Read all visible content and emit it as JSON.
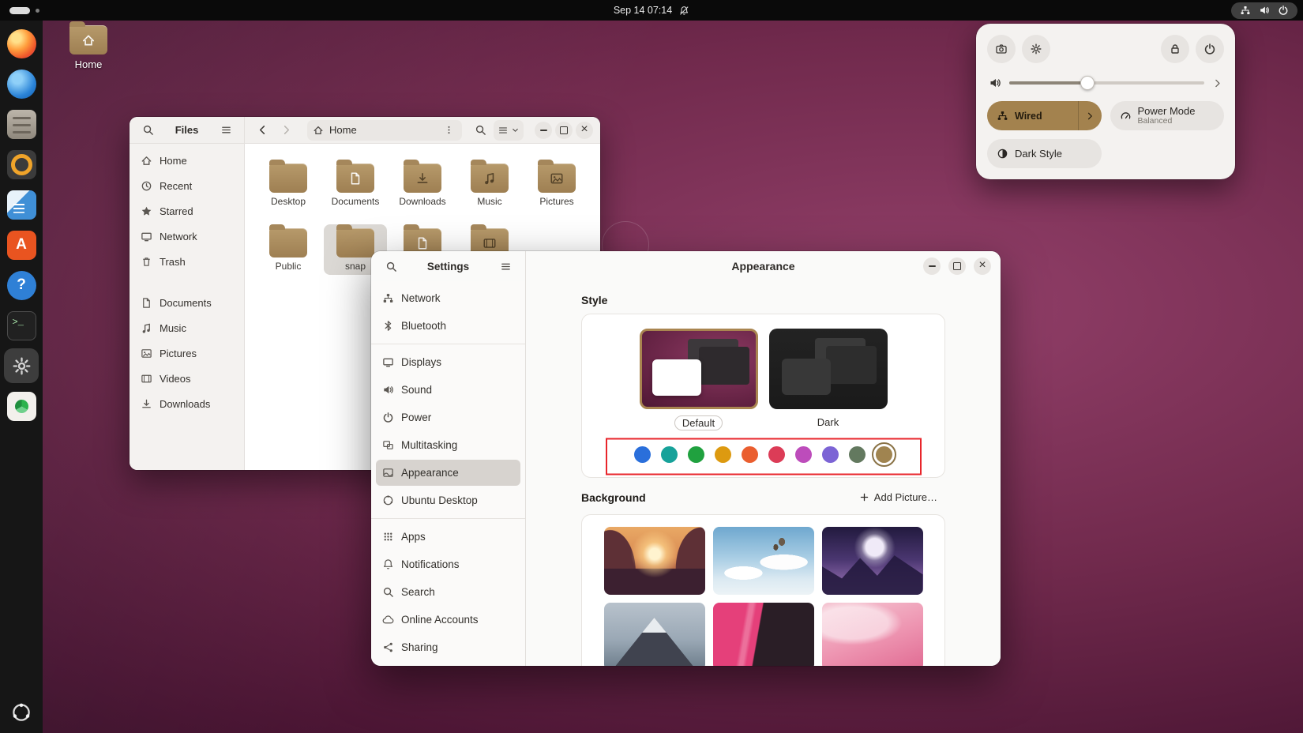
{
  "topbar": {
    "clock": "Sep 14 07:14"
  },
  "dock": {
    "items": [
      {
        "name": "firefox"
      },
      {
        "name": "thunderbird"
      },
      {
        "name": "files"
      },
      {
        "name": "rhythmbox"
      },
      {
        "name": "libreoffice-writer"
      },
      {
        "name": "ubuntu-software"
      },
      {
        "name": "help"
      },
      {
        "name": "terminal"
      },
      {
        "name": "settings",
        "active": true
      },
      {
        "name": "app-center"
      }
    ]
  },
  "desktop": {
    "home_icon_label": "Home"
  },
  "files_window": {
    "app_title": "Files",
    "tab_label": "Home",
    "sidebar_top": [
      {
        "label": "Home"
      },
      {
        "label": "Recent"
      },
      {
        "label": "Starred"
      },
      {
        "label": "Network"
      },
      {
        "label": "Trash"
      }
    ],
    "sidebar_bottom": [
      {
        "label": "Documents"
      },
      {
        "label": "Music"
      },
      {
        "label": "Pictures"
      },
      {
        "label": "Videos"
      },
      {
        "label": "Downloads"
      }
    ],
    "folders": [
      {
        "label": "Desktop",
        "emblem": "none"
      },
      {
        "label": "Documents",
        "emblem": "document"
      },
      {
        "label": "Downloads",
        "emblem": "download"
      },
      {
        "label": "Music",
        "emblem": "music"
      },
      {
        "label": "Pictures",
        "emblem": "image"
      },
      {
        "label": "Public",
        "emblem": "none"
      },
      {
        "label": "snap",
        "emblem": "none",
        "selected": true
      },
      {
        "label": "",
        "emblem": "document"
      },
      {
        "label": "",
        "emblem": "video"
      }
    ]
  },
  "settings_window": {
    "sidebar_title": "Settings",
    "nav_groups": [
      {
        "items": [
          {
            "label": "Network"
          },
          {
            "label": "Bluetooth"
          }
        ]
      },
      {
        "items": [
          {
            "label": "Displays"
          },
          {
            "label": "Sound"
          },
          {
            "label": "Power"
          },
          {
            "label": "Multitasking"
          },
          {
            "label": "Appearance",
            "selected": true
          },
          {
            "label": "Ubuntu Desktop"
          }
        ]
      },
      {
        "items": [
          {
            "label": "Apps"
          },
          {
            "label": "Notifications"
          },
          {
            "label": "Search"
          },
          {
            "label": "Online Accounts"
          },
          {
            "label": "Sharing"
          }
        ]
      }
    ],
    "panel_title": "Appearance",
    "style_section": {
      "heading": "Style",
      "options": [
        {
          "label": "Default",
          "selected": true
        },
        {
          "label": "Dark",
          "selected": false
        }
      ],
      "accent_colors": [
        "#2a6fdb",
        "#17a29a",
        "#20a13f",
        "#dd9a10",
        "#ea5e2f",
        "#dc3c57",
        "#bd4cbb",
        "#7c64d5",
        "#63795f",
        "#a08450"
      ],
      "selected_accent_index": 9
    },
    "background_section": {
      "heading": "Background",
      "add_picture_label": "Add Picture…",
      "wallpapers": [
        "desert-sunset",
        "sky-balloons",
        "purple-mountains",
        "mount-fuji",
        "pink-dark-abstract",
        "pink-soft-abstract"
      ]
    }
  },
  "quick_settings": {
    "volume_percent": 40,
    "tiles": {
      "wired": {
        "label": "Wired"
      },
      "power_mode": {
        "label": "Power Mode",
        "sublabel": "Balanced"
      },
      "dark_style": {
        "label": "Dark Style"
      }
    }
  },
  "annotation": {
    "color": "#e8252b",
    "target": "accent-color-row"
  }
}
